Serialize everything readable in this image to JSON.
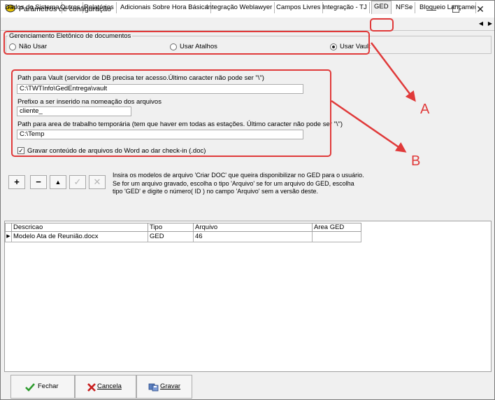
{
  "window": {
    "title": "Parâmetros de configuração",
    "controls": {
      "minimize": "—",
      "maximize": "☐",
      "close": "✕"
    }
  },
  "tabs": [
    {
      "label": "Dados do Sistema"
    },
    {
      "label": "Outros"
    },
    {
      "label": "Relatórios"
    },
    {
      "label": "Adicionais Sobre Hora Básica"
    },
    {
      "label": "Integração Weblawyer"
    },
    {
      "label": "Campos Livres"
    },
    {
      "label": "Integração - TJ"
    },
    {
      "label": "GED",
      "active": true
    },
    {
      "label": "NFSe"
    },
    {
      "label": "Bloqueio Lançamento"
    }
  ],
  "tab_scroll": {
    "left": "◀",
    "right": "▶"
  },
  "ged_mode": {
    "title": "Gerenciamento Eletônico de documentos",
    "options": [
      {
        "label": "Não Usar",
        "selected": false
      },
      {
        "label": "Usar Atalhos",
        "selected": false
      },
      {
        "label": "Usar Vault",
        "selected": true
      }
    ]
  },
  "settings": {
    "vault_path_label": "Path para Vault (servidor de DB precisa ter acesso.Último caracter não pode ser \"\\\")",
    "vault_path_value": "C:\\TWTInfo\\GedEntrega\\vault",
    "prefix_label": "Prefixo a ser inserido na nomeação dos arquivos",
    "prefix_value": "cliente_",
    "temp_path_label": "Path para area de trabalho temporária (tem que haver em todas as estações. Último caracter não pode ser \"\\\")",
    "temp_path_value": "C:\\Temp",
    "word_checkin_label": "Gravar conteúdo de arquivos do Word ao dar check-in (.doc)",
    "word_checkin_checked": true,
    "check_mark": "✓"
  },
  "toolbar": {
    "add": "+",
    "remove": "−",
    "up": "▲",
    "confirm": "✓",
    "cancel": "✕"
  },
  "info_lines": [
    "Insira os modelos de arquivo 'Criar DOC' que queira disponibilizar no GED para o usuário.",
    "Se for um arquivo gravado, escolha o tipo 'Arquivo' se for um arquivo do GED, escolha",
    "tipo 'GED' e digite o número( ID ) no campo 'Arquivo' sem a versão deste."
  ],
  "grid": {
    "columns": [
      "Descricao",
      "Tipo",
      "Arquivo",
      "Area GED"
    ],
    "row_indicator": "▶",
    "rows": [
      {
        "descricao": "Modelo Ata de Reunião.docx",
        "tipo": "GED",
        "arquivo": "46",
        "area_ged": ""
      }
    ]
  },
  "buttons": {
    "fechar": "Fechar",
    "cancela": "Cancela",
    "gravar": "Gravar"
  },
  "annotations": {
    "a": "A",
    "b": "B",
    "color": "#e03a3a"
  }
}
